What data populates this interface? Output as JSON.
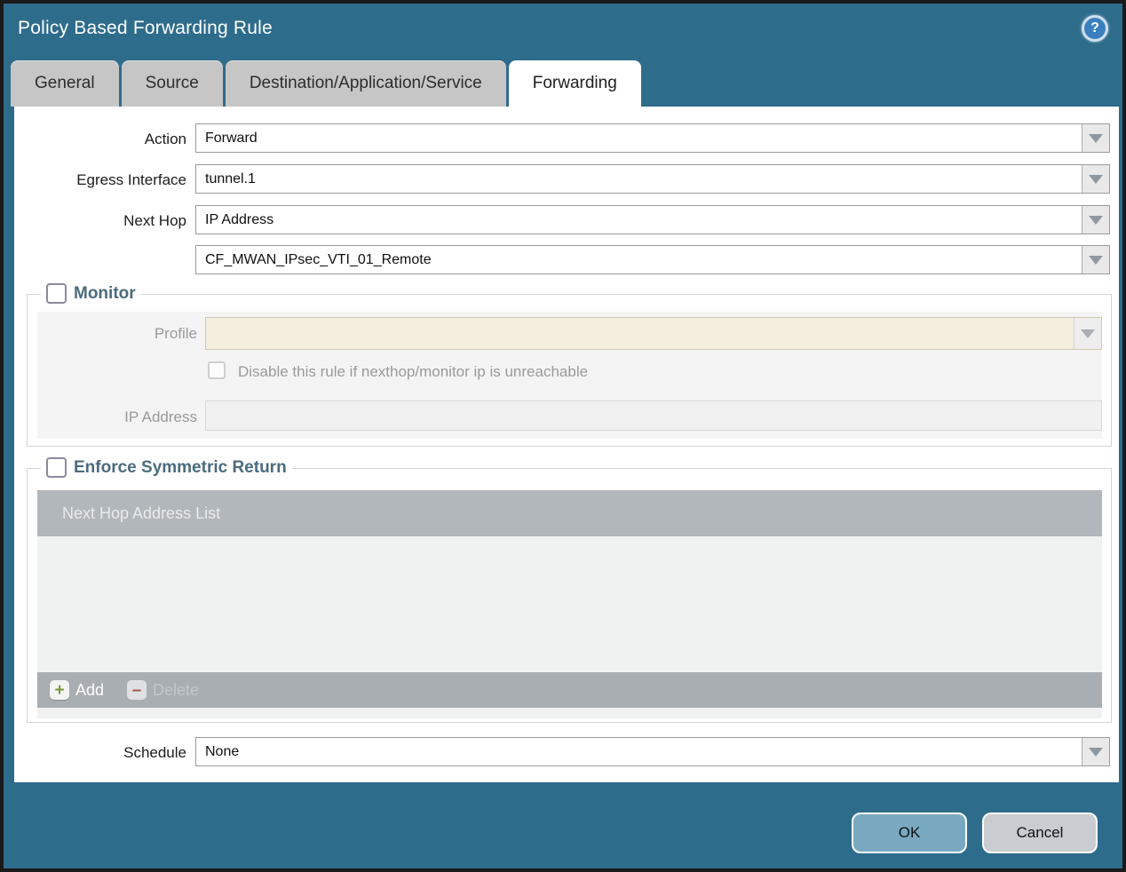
{
  "dialog": {
    "title": "Policy Based Forwarding Rule"
  },
  "tabs": [
    {
      "label": "General",
      "active": false
    },
    {
      "label": "Source",
      "active": false
    },
    {
      "label": "Destination/Application/Service",
      "active": false
    },
    {
      "label": "Forwarding",
      "active": true
    }
  ],
  "form": {
    "action": {
      "label": "Action",
      "value": "Forward"
    },
    "egress_interface": {
      "label": "Egress Interface",
      "value": "tunnel.1"
    },
    "next_hop": {
      "label": "Next Hop",
      "type_value": "IP Address",
      "address_value": "CF_MWAN_IPsec_VTI_01_Remote"
    },
    "monitor": {
      "legend": "Monitor",
      "checked": false,
      "profile": {
        "label": "Profile",
        "value": ""
      },
      "disable_rule": {
        "label": "Disable this rule if nexthop/monitor ip is unreachable",
        "checked": false
      },
      "ip_address": {
        "label": "IP Address",
        "value": ""
      }
    },
    "symmetric_return": {
      "legend": "Enforce Symmetric Return",
      "checked": false,
      "table_header": "Next Hop Address List",
      "rows": [],
      "add_label": "Add",
      "delete_label": "Delete"
    },
    "schedule": {
      "label": "Schedule",
      "value": "None"
    }
  },
  "footer": {
    "ok_label": "OK",
    "cancel_label": "Cancel"
  },
  "colors": {
    "frame_teal": "#2e6c8c",
    "tab_inactive": "#c6c6c6",
    "legend_text": "#4b6b7d",
    "disabled_field_cream": "#f3eedd",
    "table_header_gray": "#b2b7bb",
    "ok_button": "#79a9c0",
    "cancel_button": "#c9ccd0",
    "help_icon_blue": "#3a80bf"
  }
}
